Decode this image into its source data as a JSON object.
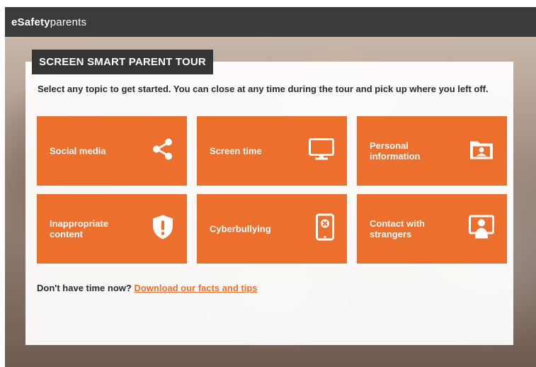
{
  "header": {
    "logo_bold": "eSafety",
    "logo_light": "parents"
  },
  "tour": {
    "title": "SCREEN SMART PARENT TOUR",
    "intro": "Select any topic to get started. You can close at any time during the tour and pick up where you left off."
  },
  "topics": [
    {
      "label": "Social media",
      "icon": "share-icon"
    },
    {
      "label": "Screen time",
      "icon": "monitor-icon"
    },
    {
      "label": "Personal information",
      "icon": "folder-person-icon"
    },
    {
      "label": "Inappropriate content",
      "icon": "shield-alert-icon"
    },
    {
      "label": "Cyberbullying",
      "icon": "phone-block-icon"
    },
    {
      "label": "Contact with strangers",
      "icon": "person-screen-icon"
    }
  ],
  "footer": {
    "prompt": "Don't have time now?",
    "link": "Download our facts and tips"
  },
  "colors": {
    "accent": "#ed6f2e",
    "header_bg": "#3b3b3b",
    "title_bg": "#353535"
  }
}
